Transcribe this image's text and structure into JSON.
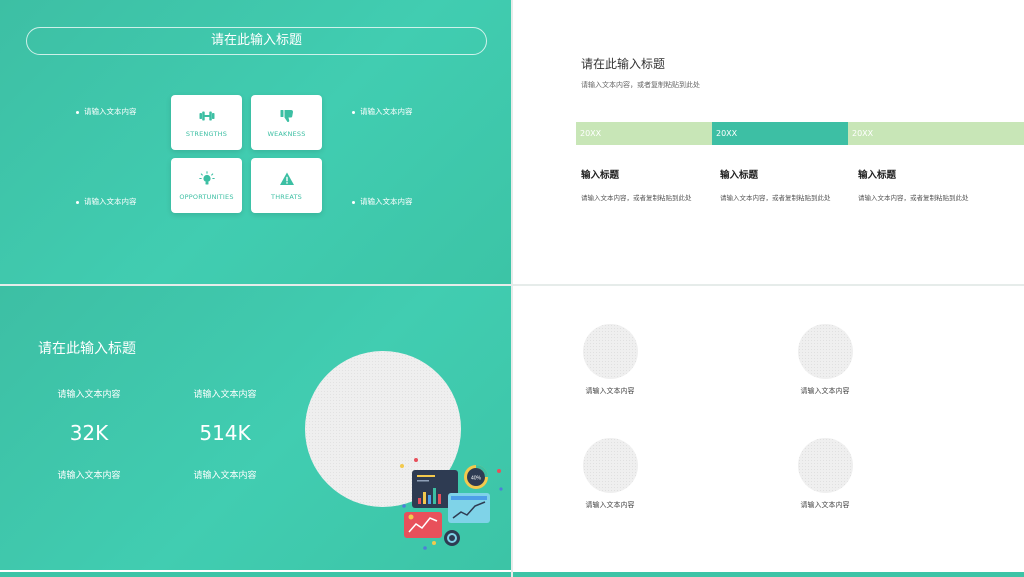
{
  "slide1": {
    "title": "请在此输入标题",
    "bullets": [
      "请输入文本内容",
      "请输入文本内容",
      "请输入文本内容",
      "请输入文本内容"
    ],
    "swot": [
      {
        "label": "STRENGTHS",
        "icon": "dumbbell-icon"
      },
      {
        "label": "WEAKNESS",
        "icon": "thumbs-down-icon"
      },
      {
        "label": "OPPORTUNITIES",
        "icon": "lightbulb-icon"
      },
      {
        "label": "THREATS",
        "icon": "warning-icon"
      }
    ],
    "accent": "#3cbfa3"
  },
  "slide2": {
    "title": "请在此输入标题",
    "subtitle": "请输入文本内容，或者复制粘贴到此处",
    "timeline": [
      {
        "label": "20XX",
        "color": "#c8e6b7"
      },
      {
        "label": "20XX",
        "color": "#3dbfa4"
      },
      {
        "label": "20XX",
        "color": "#c8e6b7"
      }
    ],
    "columns": [
      {
        "heading": "输入标题",
        "text": "请输入文本内容，或者复制粘贴到此处"
      },
      {
        "heading": "输入标题",
        "text": "请输入文本内容，或者复制粘贴到此处"
      },
      {
        "heading": "输入标题",
        "text": "请输入文本内容，或者复制粘贴到此处"
      }
    ]
  },
  "slide3": {
    "title": "请在此输入标题",
    "stats": [
      {
        "top": "请输入文本内容",
        "value": "32K",
        "bottom": "请输入文本内容"
      },
      {
        "top": "请输入文本内容",
        "value": "514K",
        "bottom": "请输入文本内容"
      }
    ],
    "gauge_label": "40%"
  },
  "slide4": {
    "labels": [
      "请输入文本内容",
      "请输入文本内容",
      "请输入文本内容",
      "请输入文本内容"
    ]
  }
}
